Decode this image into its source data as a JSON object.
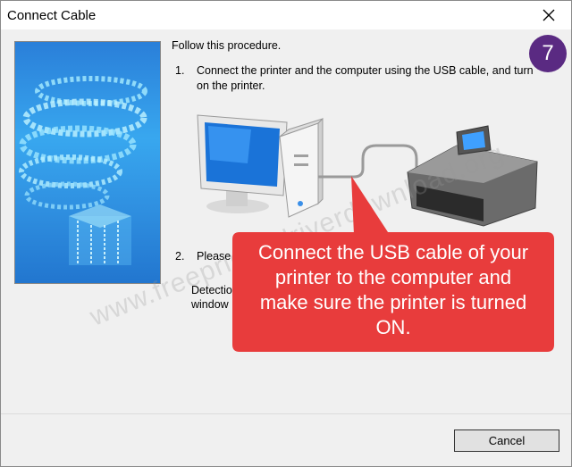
{
  "window": {
    "title": "Connect Cable",
    "close_icon": "close-icon"
  },
  "instructions": {
    "intro": "Follow this procedure.",
    "step1_number": "1.",
    "step1_text_line1": "Connect the printer and the computer using the USB cable, and turn",
    "step1_text_line2": "on the printer.",
    "step2_number": "2.",
    "step2_text_partial": "Please",
    "detection_line1": "Detectio",
    "detection_line2": "window"
  },
  "illustration": {
    "icons": [
      "monitor-icon",
      "pc-tower-icon",
      "usb-cable-icon",
      "printer-icon"
    ]
  },
  "badge": {
    "number": "7",
    "color": "#5a2a82"
  },
  "callout": {
    "line1": "Connect the USB cable of your",
    "line2": "printer to the computer and",
    "line3": "make sure the printer is turned",
    "line4": "ON.",
    "color": "#e83c3c"
  },
  "watermark": {
    "text": "www.freeprinterdriverdownload.org"
  },
  "footer": {
    "cancel_label": "Cancel"
  }
}
